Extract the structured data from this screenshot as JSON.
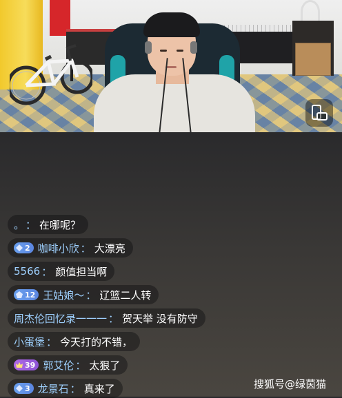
{
  "stream": {
    "rotate_icon": "screen-rotate-icon"
  },
  "chat": {
    "messages": [
      {
        "name": "。",
        "text": "在哪呢？",
        "badge": null
      },
      {
        "name": "咖啡小欣",
        "text": "大漂亮",
        "badge": {
          "level": "2",
          "color": "#6a9ef0"
        }
      },
      {
        "name": "5566",
        "text": "颜值担当啊",
        "badge": null
      },
      {
        "name": "王姑娘～",
        "text": "辽篮二人转",
        "badge": {
          "level": "12",
          "color": "#6a9ef0"
        }
      },
      {
        "name": "周杰伦回忆录一一一",
        "text": "贺天举 没有防守",
        "badge": null
      },
      {
        "name": "小蛋堡",
        "text": "今天打的不错，",
        "badge": null
      },
      {
        "name": "郭艾伦",
        "text": "太狠了",
        "badge": {
          "level": "39",
          "color": "#a863e6"
        }
      },
      {
        "name": "龙景石",
        "text": "真来了",
        "badge": {
          "level": "3",
          "color": "#6a9ef0"
        }
      }
    ],
    "separator": "："
  },
  "watermark": "搜狐号@绿茵猫",
  "colors": {
    "name": "#9fd1ff",
    "text": "#ffffff",
    "bubble": "rgba(12,12,14,0.42)"
  }
}
